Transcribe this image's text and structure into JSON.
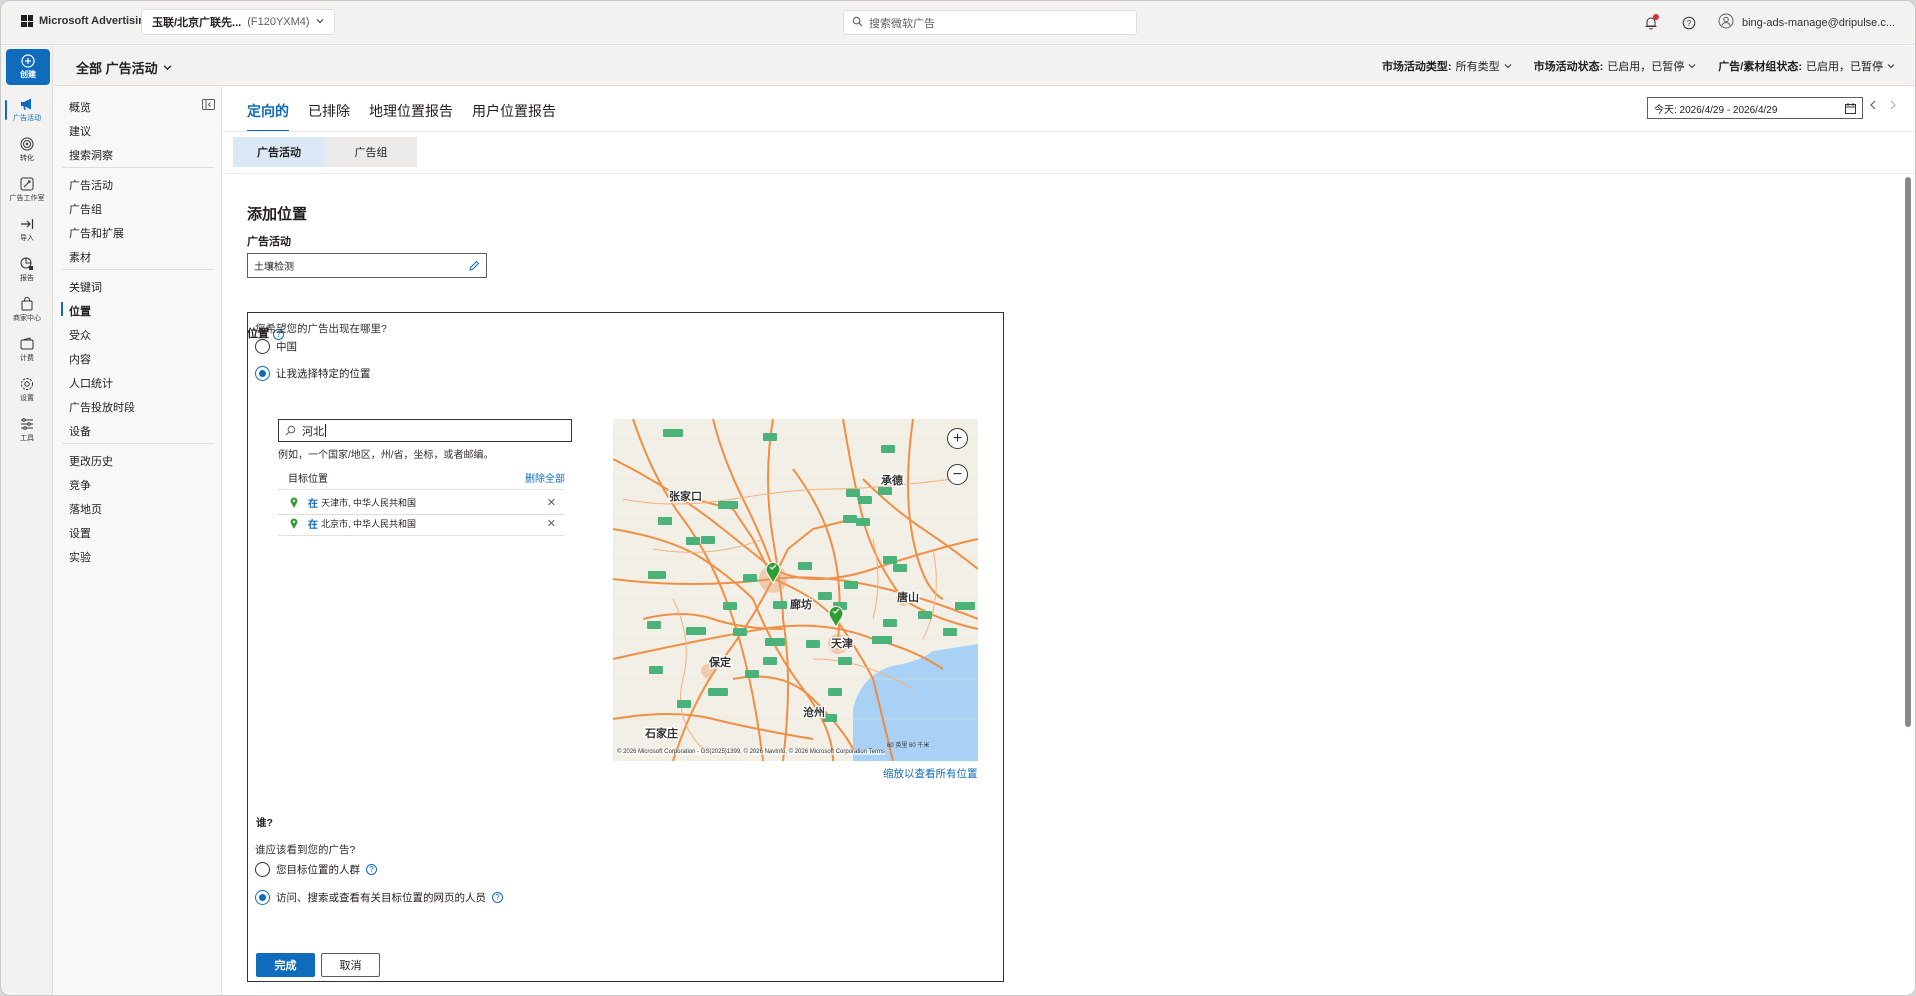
{
  "header": {
    "brand": "Microsoft Advertising",
    "account_name": "玉联/北京广联先...",
    "account_id": "(F120YXM4)",
    "search_placeholder": "搜索微软广告",
    "user_email": "bing-ads-manage@dripulse.c..."
  },
  "scope": {
    "title": "全部 广告活动",
    "filters": [
      {
        "label": "市场活动类型:",
        "value": "所有类型"
      },
      {
        "label": "市场活动状态:",
        "value": "已启用，已暂停"
      },
      {
        "label": "广告/素材组状态:",
        "value": "已启用，已暂停"
      }
    ]
  },
  "rail": {
    "create_label": "创建",
    "items": [
      {
        "label": "广告活动",
        "icon": "megaphone-icon"
      },
      {
        "label": "转化",
        "icon": "target-icon"
      },
      {
        "label": "广告工作室",
        "icon": "studio-icon"
      },
      {
        "label": "导入",
        "icon": "import-icon"
      },
      {
        "label": "报告",
        "icon": "report-icon"
      },
      {
        "label": "商家中心",
        "icon": "shopping-bag-icon"
      },
      {
        "label": "计费",
        "icon": "wallet-icon"
      },
      {
        "label": "设置",
        "icon": "gear-icon"
      },
      {
        "label": "工具",
        "icon": "tools-icon"
      }
    ]
  },
  "nav": {
    "items": [
      "概览",
      "建议",
      "搜索洞察",
      "广告活动",
      "广告组",
      "广告和扩展",
      "素材",
      "关键词",
      "位置",
      "受众",
      "内容",
      "人口统计",
      "广告投放时段",
      "设备",
      "更改历史",
      "竞争",
      "落地页",
      "设置",
      "实验"
    ],
    "active": "位置"
  },
  "tabs": [
    "定向的",
    "已排除",
    "地理位置报告",
    "用户位置报告"
  ],
  "date_range": "今天: 2026/4/29 - 2026/4/29",
  "subtabs": [
    "广告活动",
    "广告组"
  ],
  "form": {
    "heading": "添加位置",
    "campaign_label": "广告活动",
    "campaign_value": "土壤检测",
    "location_label": "位置",
    "where_question": "您希望您的广告出现在哪里?",
    "option_china": "中国",
    "option_custom": "让我选择特定的位置",
    "search_value": "河北",
    "hint": "例如，一个国家/地区，州/省，坐标，或者邮编。",
    "target_header": "目标位置",
    "delete_all": "删除全部",
    "locations": [
      {
        "prefix": "在",
        "place": "天津市, 中华人民共和国"
      },
      {
        "prefix": "在",
        "place": "北京市, 中华人民共和国"
      }
    ],
    "zoom_link": "缩放以查看所有位置",
    "who_heading": "谁?",
    "who_question": "谁应该看到您的广告?",
    "who_option1": "您目标位置的人群",
    "who_option2": "访问、搜索或查看有关目标位置的网页的人员",
    "done": "完成",
    "cancel": "取消"
  },
  "map": {
    "cities": [
      "张家口",
      "承德",
      "廊坊",
      "唐山",
      "天津",
      "保定",
      "沧州",
      "石家庄"
    ],
    "credit": "© 2026 Microsoft Corporation - GS(2025)1399, © 2026 NavInfo, © 2026 Microsoft Corporation   Terms",
    "scale": "60 英里    60 千米"
  },
  "colors": {
    "accent": "#0f6cbd",
    "road": "#f08a3c",
    "water": "#a8d1f5",
    "pin": "#2e9e33"
  }
}
